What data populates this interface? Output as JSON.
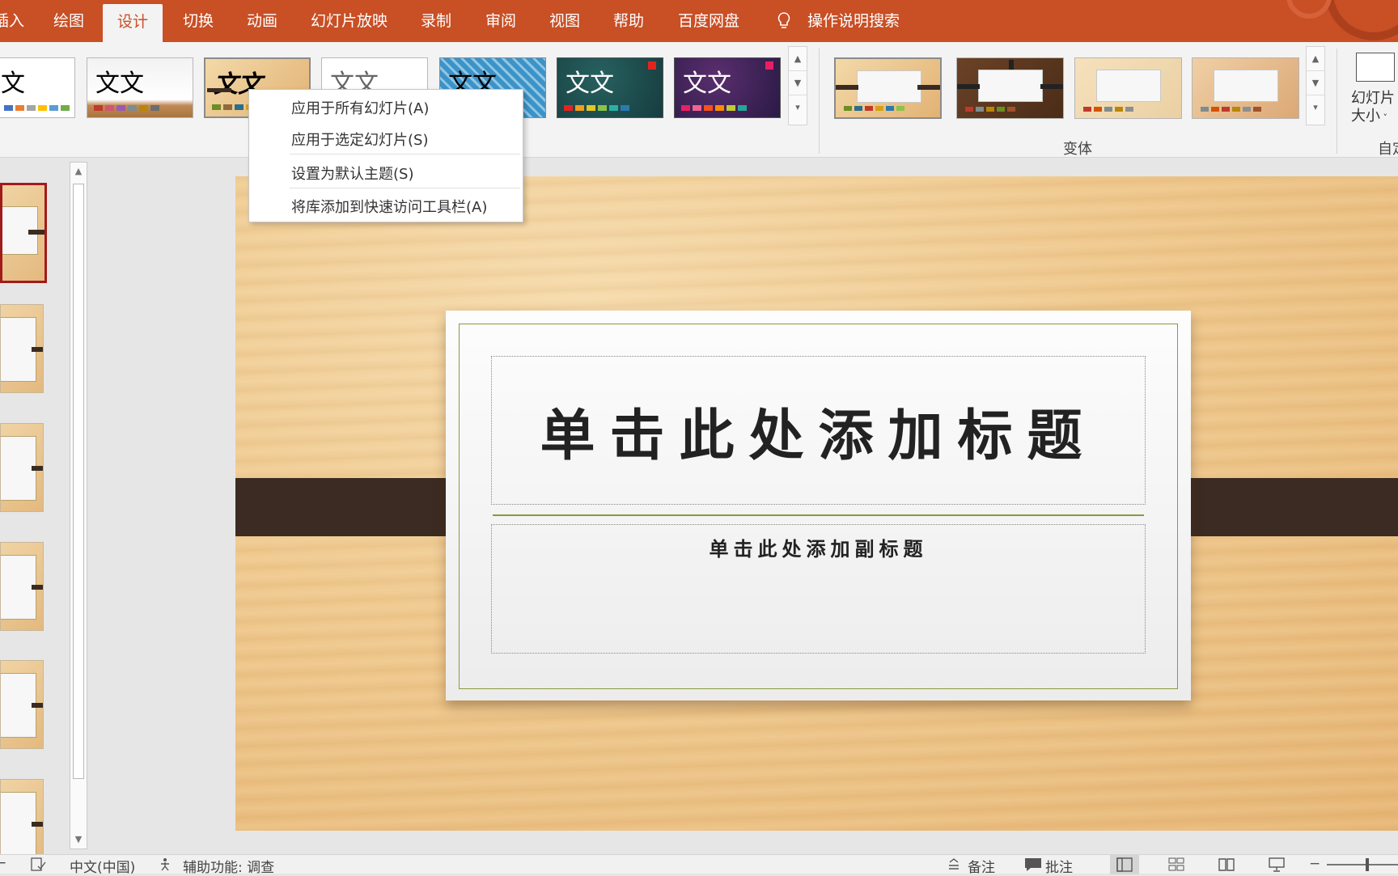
{
  "ribbon": {
    "tabs": [
      {
        "label": "插入",
        "visible_text": "插入"
      },
      {
        "label": "绘图"
      },
      {
        "label": "设计"
      },
      {
        "label": "切换"
      },
      {
        "label": "动画"
      },
      {
        "label": "幻灯片放映"
      },
      {
        "label": "录制"
      },
      {
        "label": "审阅"
      },
      {
        "label": "视图"
      },
      {
        "label": "帮助"
      },
      {
        "label": "百度网盘"
      }
    ],
    "tell_me": "操作说明搜索",
    "theme_sample_text": "文文",
    "variants_label": "变体",
    "slide_size_label_1": "幻灯片",
    "slide_size_label_2": "大小",
    "customize_label": "自定"
  },
  "context_menu": {
    "items": [
      "应用于所有幻灯片(A)",
      "应用于选定幻灯片(S)",
      "设置为默认主题(S)",
      "将库添加到快速访问工具栏(A)"
    ]
  },
  "slide": {
    "title_placeholder": "单击此处添加标题",
    "subtitle_placeholder": "单击此处添加副标题"
  },
  "status_bar": {
    "language": "中文(中国)",
    "accessibility": "辅助功能: 调查",
    "notes": "备注",
    "comments": "批注"
  },
  "colors": {
    "accent": "#c94f25",
    "strap": "#3b2b22",
    "card_border": "#8a9a3b"
  }
}
